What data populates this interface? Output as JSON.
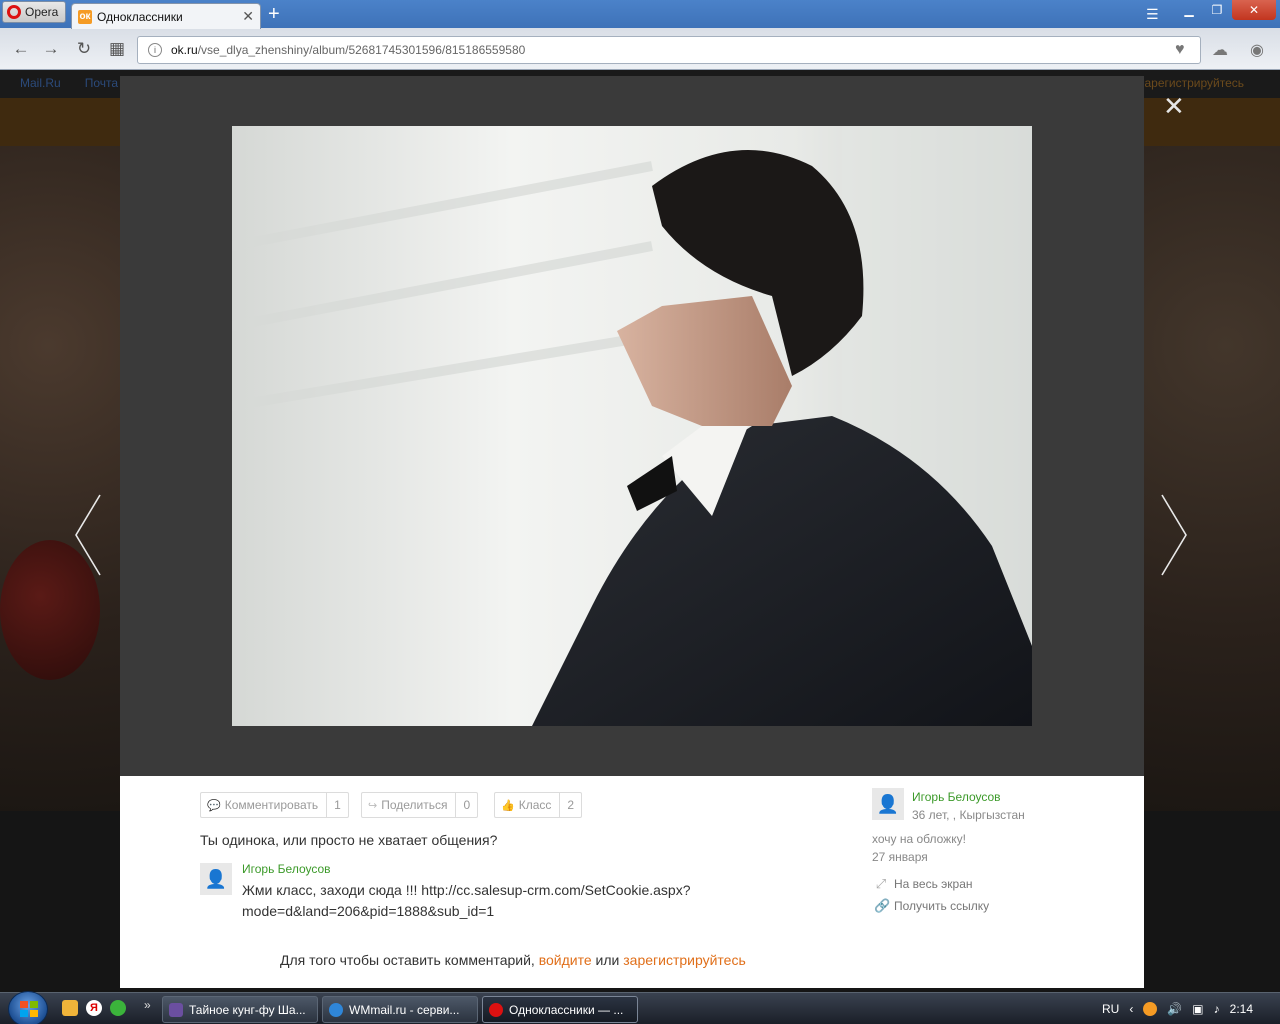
{
  "browser": {
    "menu_label": "Opera",
    "tab_title": "Одноклассники",
    "tab_favicon": "ok-logo-icon",
    "url_domain": "ok.ru",
    "url_path": "/vse_dlya_zhenshiny/album/52681745301596/815186559580"
  },
  "background_page": {
    "links": [
      "Mail.Ru",
      "Почта"
    ],
    "register": "зарегистрируйтесь"
  },
  "photo_viewer": {
    "image_alt": "фото",
    "actions": {
      "comment": {
        "label": "Комментировать",
        "count": "1"
      },
      "share": {
        "label": "Поделиться",
        "count": "0"
      },
      "class": {
        "label": "Класс",
        "count": "2"
      }
    },
    "caption": "Ты одинока, или просто не хватает общения?",
    "comment": {
      "author": "Игорь Белоусов",
      "text": "Жми класс, заходи сюда !!!  http://cc.salesup-crm.com/SetCookie.aspx?mode=d&land=206&pid=1888&sub_id=1"
    },
    "login_prompt": {
      "prefix": "Для того чтобы оставить комментарий,",
      "login": "войдите",
      "or": "или",
      "register": "зарегистрируйтесь"
    },
    "owner": {
      "name": "Игорь Белоусов",
      "meta": "36 лет, , Кыргызстан"
    },
    "description": "хочу на обложку!",
    "date": "27 января",
    "fullscreen": "На весь экран",
    "get_link": "Получить ссылку"
  },
  "taskbar": {
    "tasks": [
      {
        "label": "Тайное кунг-фу Ша..."
      },
      {
        "label": "WMmail.ru - серви..."
      },
      {
        "label": "Одноклассники — ..."
      }
    ],
    "lang": "RU",
    "time": "2:14"
  },
  "colors": {
    "link_green": "#3c9a2a",
    "link_orange": "#e06f1a",
    "overlay": "#3a3a3a"
  }
}
